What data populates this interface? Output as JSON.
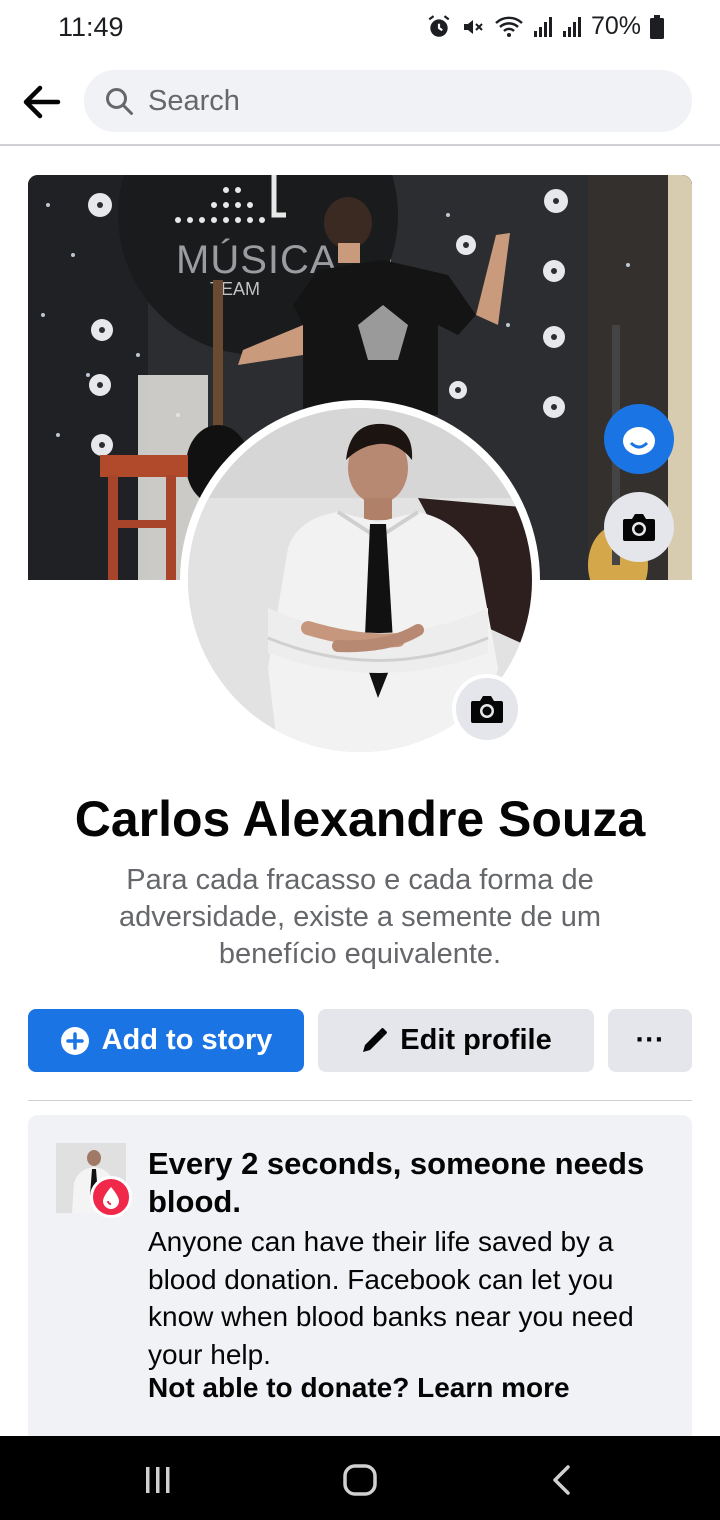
{
  "status_bar": {
    "time": "11:49",
    "battery": "70%",
    "icons": [
      "alarm-icon",
      "mute-icon",
      "wifi-icon",
      "signal-icon",
      "signal-icon",
      "battery-icon"
    ]
  },
  "search": {
    "placeholder": "Search",
    "back_icon": "arrow-left-icon",
    "search_icon": "magnifier-icon"
  },
  "cover": {
    "sign_text": "MÚSICA",
    "sign_subtext": "TEAM"
  },
  "profile": {
    "name": "Carlos Alexandre Souza",
    "bio": "Para cada fracasso e cada forma de adversidade, existe a semente de um benefício equivalente."
  },
  "actions": {
    "add_story_label": "Add to story",
    "edit_profile_label": "Edit profile",
    "more_label": "···"
  },
  "blood_card": {
    "title": "Every 2 seconds, someone needs blood.",
    "body": "Anyone can have their life saved by a blood donation. Facebook can let you know when blood banks near you need your help.",
    "link": "Not able to donate? Learn more"
  },
  "nav": {
    "recent_icon": "recent-apps-icon",
    "home_icon": "home-icon",
    "back_icon": "back-icon"
  },
  "colors": {
    "accent": "#1b74e4",
    "button_gray": "#e4e6eb",
    "card_bg": "#f0f2f5",
    "secondary_text": "#65676b",
    "blood_red": "#f02849"
  }
}
